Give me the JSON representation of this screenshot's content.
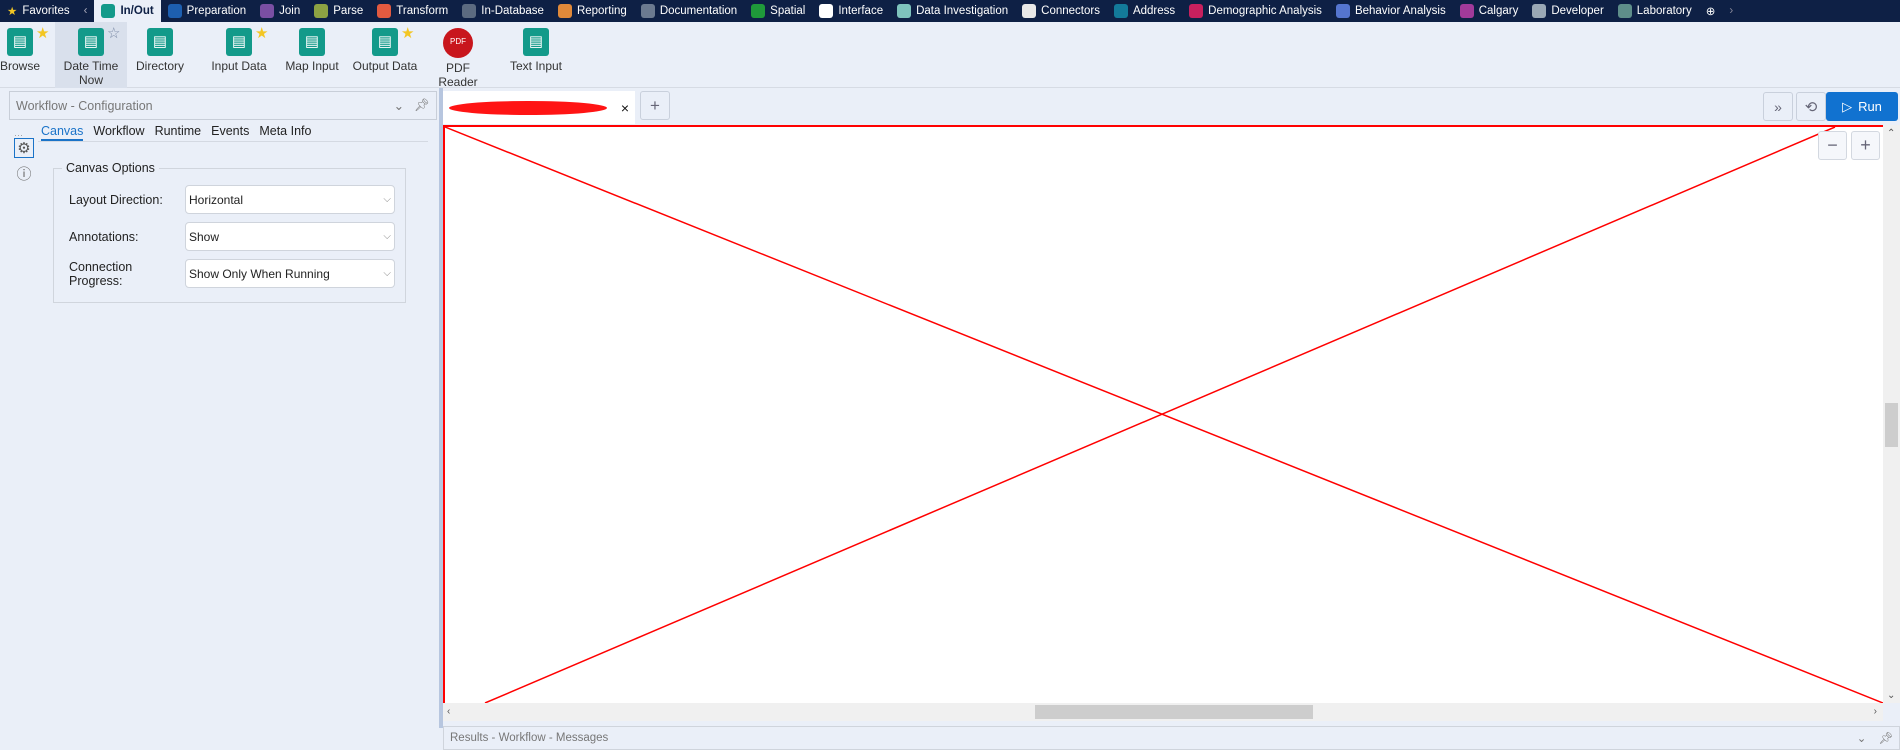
{
  "nav": {
    "items": [
      {
        "label": "Favorites",
        "color": "#f3c623",
        "active": false
      },
      {
        "label": "In/Out",
        "color": "#139a8a",
        "active": true
      },
      {
        "label": "Preparation",
        "color": "#1d5fb0",
        "active": false
      },
      {
        "label": "Join",
        "color": "#7a4fa3",
        "active": false
      },
      {
        "label": "Parse",
        "color": "#8da243",
        "active": false
      },
      {
        "label": "Transform",
        "color": "#e25a40",
        "active": false
      },
      {
        "label": "In-Database",
        "color": "#5c6b80",
        "active": false
      },
      {
        "label": "Reporting",
        "color": "#e0893a",
        "active": false
      },
      {
        "label": "Documentation",
        "color": "#6b7a90",
        "active": false
      },
      {
        "label": "Spatial",
        "color": "#1f9a3a",
        "active": false
      },
      {
        "label": "Interface",
        "color": "#ffffff",
        "active": false
      },
      {
        "label": "Data Investigation",
        "color": "#7ec3bd",
        "active": false
      },
      {
        "label": "Connectors",
        "color": "#e8e8e8",
        "active": false
      },
      {
        "label": "Address",
        "color": "#137a9a",
        "active": false
      },
      {
        "label": "Demographic Analysis",
        "color": "#c8205e",
        "active": false
      },
      {
        "label": "Behavior Analysis",
        "color": "#5575cf",
        "active": false
      },
      {
        "label": "Calgary",
        "color": "#a13a9a",
        "active": false
      },
      {
        "label": "Developer",
        "color": "#9aa8b5",
        "active": false
      },
      {
        "label": "Laboratory",
        "color": "#5e8e8a",
        "active": false
      }
    ]
  },
  "tools": [
    {
      "label": "Browse",
      "starred": true
    },
    {
      "label": "Date Time Now",
      "starred": false
    },
    {
      "label": "Directory",
      "starred": false
    },
    {
      "label": "Input Data",
      "starred": true
    },
    {
      "label": "Map Input",
      "starred": false
    },
    {
      "label": "Output Data",
      "starred": true
    },
    {
      "label": "PDF Reader",
      "starred": false
    },
    {
      "label": "Text Input",
      "starred": false
    }
  ],
  "config": {
    "title": "Workflow - Configuration",
    "tabs": [
      "Canvas",
      "Workflow",
      "Runtime",
      "Events",
      "Meta Info"
    ],
    "group_title": "Canvas Options",
    "fields": [
      {
        "label": "Layout Direction:",
        "value": "Horizontal"
      },
      {
        "label": "Annotations:",
        "value": "Show"
      },
      {
        "label": "Connection Progress:",
        "value": "Show Only When Running"
      }
    ]
  },
  "canvas": {
    "run_label": "Run",
    "close": "×",
    "add": "+"
  },
  "results": {
    "title": "Results - Workflow - Messages"
  }
}
